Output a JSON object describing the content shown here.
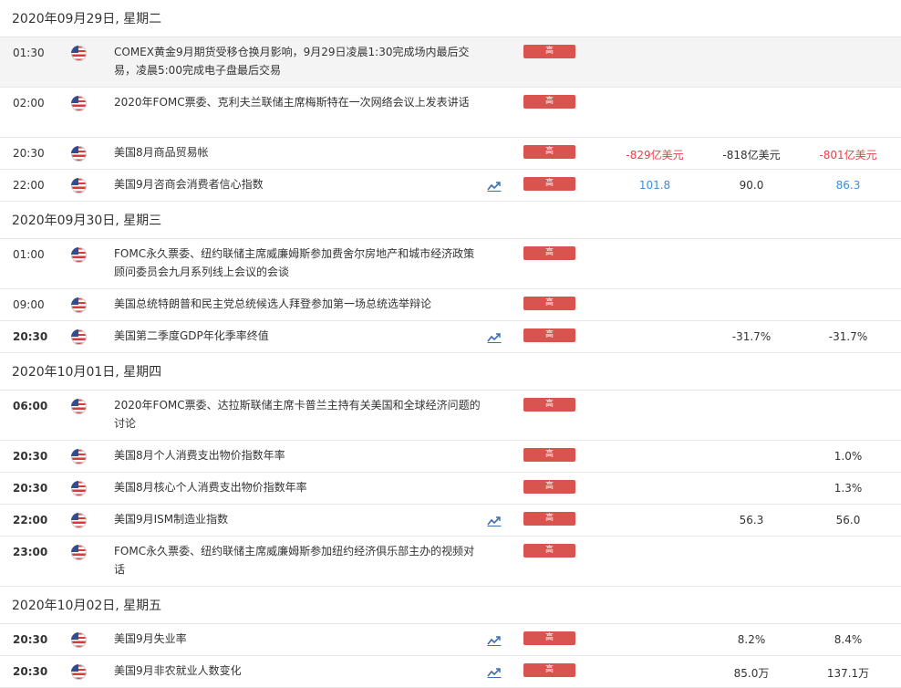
{
  "colors": {
    "badge_bg": "#d9534f",
    "red": "#e5414b",
    "blue": "#3a8fd8",
    "highlight_row": "#f4f4f4"
  },
  "icons": {
    "flag": "us-flag-icon",
    "chart": "chart-line-icon"
  },
  "days": [
    {
      "date": "2020年09月29日, 星期二",
      "events": [
        {
          "time": "01:30",
          "bold": false,
          "highlight": true,
          "title": "COMEX黄金9月期货受移仓换月影响，9月29日凌晨1:30完成场内最后交易，凌晨5:00完成电子盘最后交易",
          "chart": false,
          "importance": "高",
          "actual": "",
          "forecast": "",
          "previous": "",
          "actual_color": "",
          "previous_color": ""
        },
        {
          "time": "02:00",
          "bold": false,
          "highlight": false,
          "title": "2020年FOMC票委、克利夫兰联储主席梅斯特在一次网络会议上发表讲话",
          "chart": false,
          "importance": "高",
          "actual": "",
          "forecast": "",
          "previous": "",
          "actual_color": "",
          "previous_color": ""
        },
        {
          "time": "20:30",
          "bold": false,
          "highlight": false,
          "title": "美国8月商品贸易帐",
          "chart": false,
          "importance": "高",
          "actual": "-829亿美元",
          "forecast": "-818亿美元",
          "previous": "-801亿美元",
          "actual_color": "red",
          "previous_color": "red"
        },
        {
          "time": "22:00",
          "bold": false,
          "highlight": false,
          "title": "美国9月咨商会消费者信心指数",
          "chart": true,
          "importance": "高",
          "actual": "101.8",
          "forecast": "90.0",
          "previous": "86.3",
          "actual_color": "blue",
          "previous_color": "blue"
        }
      ]
    },
    {
      "date": "2020年09月30日, 星期三",
      "events": [
        {
          "time": "01:00",
          "bold": false,
          "highlight": false,
          "title": "FOMC永久票委、纽约联储主席威廉姆斯参加费舍尔房地产和城市经济政策顾问委员会九月系列线上会议的会谈",
          "chart": false,
          "importance": "高",
          "actual": "",
          "forecast": "",
          "previous": "",
          "actual_color": "",
          "previous_color": ""
        },
        {
          "time": "09:00",
          "bold": false,
          "highlight": false,
          "title": "美国总统特朗普和民主党总统候选人拜登参加第一场总统选举辩论",
          "chart": false,
          "importance": "高",
          "actual": "",
          "forecast": "",
          "previous": "",
          "actual_color": "",
          "previous_color": ""
        },
        {
          "time": "20:30",
          "bold": true,
          "highlight": false,
          "title": "美国第二季度GDP年化季率终值",
          "chart": true,
          "importance": "高",
          "actual": "",
          "forecast": "-31.7%",
          "previous": "-31.7%",
          "actual_color": "",
          "previous_color": "dark"
        }
      ]
    },
    {
      "date": "2020年10月01日, 星期四",
      "events": [
        {
          "time": "06:00",
          "bold": true,
          "highlight": false,
          "title": "2020年FOMC票委、达拉斯联储主席卡普兰主持有关美国和全球经济问题的讨论",
          "chart": false,
          "importance": "高",
          "actual": "",
          "forecast": "",
          "previous": "",
          "actual_color": "",
          "previous_color": ""
        },
        {
          "time": "20:30",
          "bold": true,
          "highlight": false,
          "title": "美国8月个人消费支出物价指数年率",
          "chart": false,
          "importance": "高",
          "actual": "",
          "forecast": "",
          "previous": "1.0%",
          "actual_color": "",
          "previous_color": "dark"
        },
        {
          "time": "20:30",
          "bold": true,
          "highlight": false,
          "title": "美国8月核心个人消费支出物价指数年率",
          "chart": false,
          "importance": "高",
          "actual": "",
          "forecast": "",
          "previous": "1.3%",
          "actual_color": "",
          "previous_color": "dark"
        },
        {
          "time": "22:00",
          "bold": true,
          "highlight": false,
          "title": "美国9月ISM制造业指数",
          "chart": true,
          "importance": "高",
          "actual": "",
          "forecast": "56.3",
          "previous": "56.0",
          "actual_color": "",
          "previous_color": "dark"
        },
        {
          "time": "23:00",
          "bold": true,
          "highlight": false,
          "title": "FOMC永久票委、纽约联储主席威廉姆斯参加纽约经济俱乐部主办的视频对话",
          "chart": false,
          "importance": "高",
          "actual": "",
          "forecast": "",
          "previous": "",
          "actual_color": "",
          "previous_color": ""
        }
      ]
    },
    {
      "date": "2020年10月02日, 星期五",
      "events": [
        {
          "time": "20:30",
          "bold": true,
          "highlight": false,
          "title": "美国9月失业率",
          "chart": true,
          "importance": "高",
          "actual": "",
          "forecast": "8.2%",
          "previous": "8.4%",
          "actual_color": "",
          "previous_color": "dark"
        },
        {
          "time": "20:30",
          "bold": true,
          "highlight": false,
          "title": "美国9月非农就业人数变化",
          "chart": true,
          "importance": "高",
          "actual": "",
          "forecast": "85.0万",
          "previous": "137.1万",
          "actual_color": "",
          "previous_color": "dark"
        }
      ]
    }
  ]
}
